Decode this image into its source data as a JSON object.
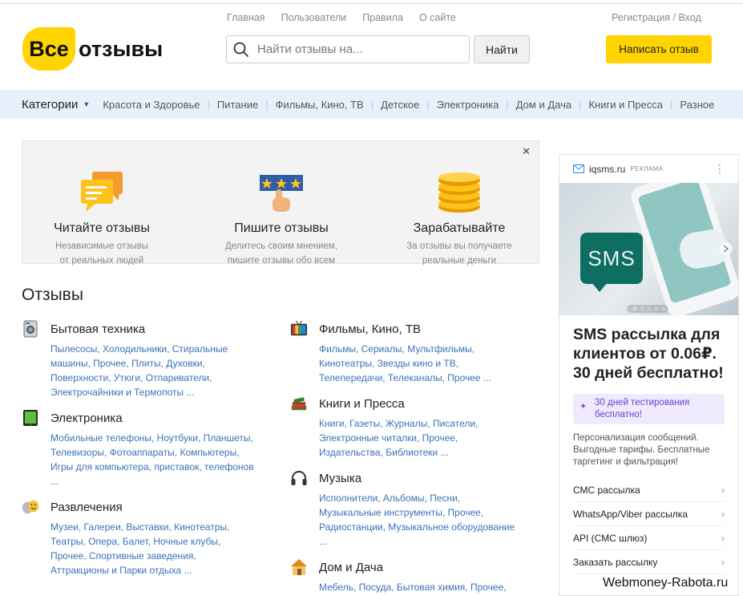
{
  "header": {
    "logo_badge": "Все",
    "logo_text": "отзывы",
    "nav": [
      "Главная",
      "Пользователи",
      "Правила",
      "О сайте"
    ],
    "auth": "Регистрация / Вход",
    "search_placeholder": "Найти отзывы на...",
    "search_button": "Найти",
    "write_button": "Написать отзыв",
    "accent": "#ffd400"
  },
  "categories": {
    "title": "Категории",
    "items": [
      "Красота и Здоровье",
      "Питание",
      "Фильмы, Кино, ТВ",
      "Детское",
      "Электроника",
      "Дом и Дача",
      "Книги и Пресса",
      "Разное"
    ]
  },
  "promo": {
    "cols": [
      {
        "icon": "chat-bubbles-icon",
        "title": "Читайте отзывы",
        "text1": "Независимые отзывы",
        "text2": "от реальных людей"
      },
      {
        "icon": "rating-stars-hand-icon",
        "title": "Пишите отзывы",
        "text1": "Делитесь своим мнением,",
        "text2": "пишите отзывы обо всем"
      },
      {
        "icon": "coins-stack-icon",
        "title": "Зарабатывайте",
        "text1": "За отзывы вы получаете",
        "text2": "реальные деньги"
      }
    ]
  },
  "reviews": {
    "title": "Отзывы",
    "groups": [
      {
        "name": "Бытовая техника",
        "icon": "washing-machine-icon",
        "links": "Пылесосы, Холодильники, Стиральные машины, Прочее, Плиты, Духовки, Поверхности, Утюги, Отпариватели, Электрочайники и Термопоты ..."
      },
      {
        "name": "Электроника",
        "icon": "tablet-icon",
        "links": "Мобильные телефоны, Ноутбуки, Планшеты, Телевизоры, Фотоаппараты, Компьютеры, Игры для компьютера, приставок, телефонов ..."
      },
      {
        "name": "Развлечения",
        "icon": "theater-masks-icon",
        "links": "Музеи, Галереи, Выставки, Кинотеатры, Театры, Опера, Балет, Ночные клубы, Прочее, Спортивные заведения, Аттракционы и Парки отдыха ..."
      },
      {
        "name": "Фильмы, Кино, ТВ",
        "icon": "tv-icon",
        "links": "Фильмы, Сериалы, Мультфильмы, Кинотеатры, Звезды кино и ТВ, Телепередачи, Телеканалы, Прочее ..."
      },
      {
        "name": "Книги и Пресса",
        "icon": "books-icon",
        "links": "Книги, Газеты, Журналы, Писатели, Электронные читалки, Прочее, Издательства, Библиотеки ..."
      },
      {
        "name": "Музыка",
        "icon": "headphones-icon",
        "links": "Исполнители, Альбомы, Песни, Музыкальные инструменты, Прочее, Радиостанции, Музыкальное оборудование ..."
      },
      {
        "name": "Дом и Дача",
        "icon": "house-icon",
        "links": "Мебель, Посуда, Бытовая химия, Прочее,"
      }
    ]
  },
  "ad": {
    "domain": "iqsms.ru",
    "mark": "РЕКЛАМА",
    "sms_label": "SMS",
    "title": "SMS рассылка для клиентов от 0.06₽. 30 дней бесплатно!",
    "promo": "30 дней тестирования бесплатно!",
    "desc": "Персонализация сообщений. Выгодные тарифы. Бесплатные таргетинг и фильтрация!",
    "links": [
      "СМС рассылка",
      "WhatsApp/Viber рассылка",
      "API (СМС шлюз)",
      "Заказать рассылку"
    ]
  },
  "watermark": "Webmoney-Rabota.ru"
}
